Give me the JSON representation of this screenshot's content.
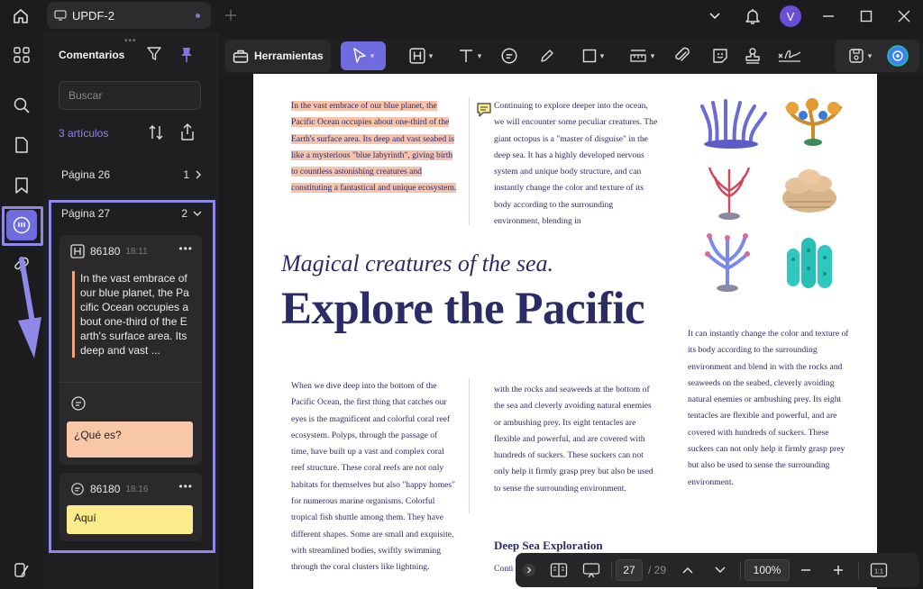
{
  "titlebar": {
    "tab_title": "UPDF-2",
    "avatar_letter": "V"
  },
  "panel": {
    "title": "Comentarios",
    "search_placeholder": "Buscar",
    "count": "3 artículos",
    "pages": [
      {
        "label": "Página 26",
        "count": "1"
      },
      {
        "label": "Página 27",
        "count": "2"
      }
    ],
    "comments": [
      {
        "id": "86180",
        "time": "18:11",
        "quote": "In the vast embrace of our blue planet, the Pacific Ocean occupies about one-third of the Earth's surface area. Its deep and vast ...",
        "note": "¿Qué es?",
        "note_color": "#f8c7a8"
      },
      {
        "id": "86180",
        "time": "18:16",
        "note": "Aquí",
        "note_color": "#fbeb8a"
      }
    ]
  },
  "toolbar": {
    "tools_label": "Herramientas"
  },
  "document": {
    "col1_top": "In the vast embrace of our blue planet, the Pacific Ocean occupies about one-third of the Earth's surface area. Its deep and vast seabed is like a mysterious \"blue labyrinth\", giving birth to countless astonishing creatures and constituting a fantastical and unique ecosystem.",
    "col2_top": "Continuing to explore deeper into the ocean, we will encounter some peculiar creatures. The giant octopus is a \"master of disguise\" in the deep sea. It has a highly developed nervous system and unique body structure, and can instantly change the color and texture of its body according to the surrounding environment, blending in",
    "subtitle": "Magical creatures of the sea.",
    "title": "Explore the Pacific",
    "col3_right": "It can instantly change the color and texture of its body according to the surrounding environment and blend in with the rocks and seaweeds on the seabed, cleverly avoiding natural enemies or ambushing prey. Its eight tentacles are flexible and powerful, and are covered with hundreds of suckers. These suckers can not only help it firmly grasp prey but also be used to sense the surrounding environment.",
    "col1_bottom": "When we dive deep into the bottom of the Pacific Ocean, the first thing that catches our eyes is the magnificent and colorful coral reef ecosystem. Polyps, through the passage of time, have built up a vast and complex coral reef structure. These coral reefs are not only habitats for themselves but also \"happy homes\" for numerous marine organisms. Colorful tropical fish shuttle among them. They have different shapes. Some are small and exquisite, with streamlined bodies, swiftly swimming through the coral clusters like lightning.",
    "col2_bottom": "with the rocks and seaweeds at the bottom of the sea and cleverly avoiding natural enemies or ambushing prey. Its eight tentacles are flexible and powerful, and are covered with hundreds of suckers. These suckers can not only help it firmly grasp prey but also be used to sense the surrounding environment.",
    "heading2": "Deep Sea Exploration",
    "col2_bottom_after": "Conti"
  },
  "navbar": {
    "current_page": "27",
    "total_pages": "/ 29",
    "zoom": "100%"
  },
  "colors": {
    "accent": "#6f6ce0",
    "highlight": "#f6c3ad",
    "doc_text": "#2b2c66"
  }
}
